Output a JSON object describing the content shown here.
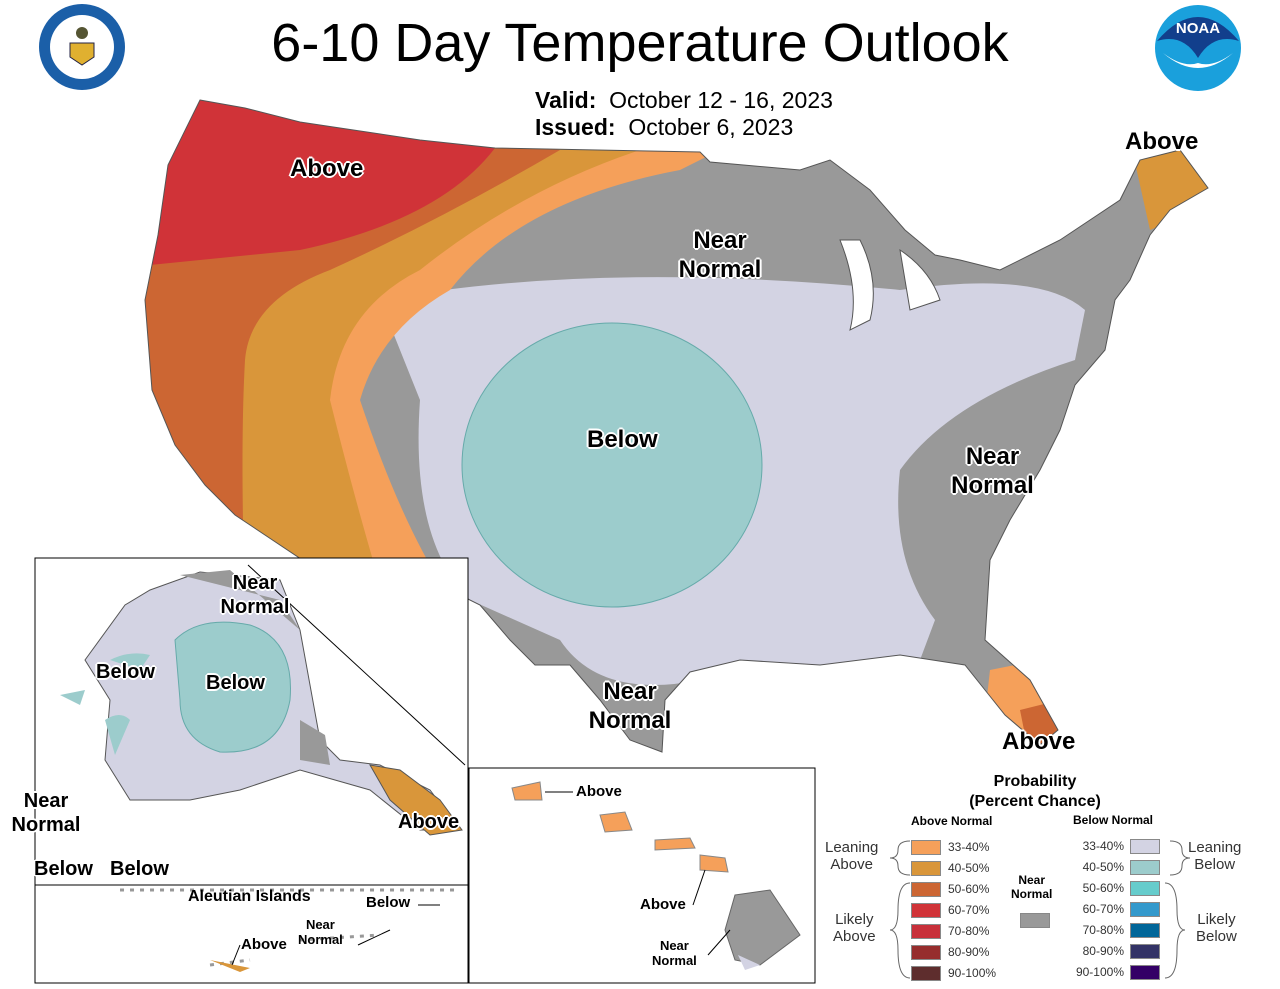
{
  "header": {
    "title": "6-10 Day Temperature Outlook",
    "valid_label": "Valid:",
    "valid_value": "October 12 - 16, 2023",
    "issued_label": "Issued:",
    "issued_value": "October 6, 2023",
    "left_logo": "DEPARTMENT OF COMMERCE UNITED STATES OF AMERICA",
    "right_logo": "NOAA"
  },
  "map_labels": {
    "conus_nw": "Above",
    "conus_north_1": "Near",
    "conus_north_2": "Normal",
    "conus_center": "Below",
    "conus_east_1": "Near",
    "conus_east_2": "Normal",
    "conus_south_1": "Near",
    "conus_south_2": "Normal",
    "conus_maine": "Above",
    "conus_florida": "Above"
  },
  "alaska": {
    "near_normal_1": "Near",
    "near_normal_2": "Normal",
    "below_west": "Below",
    "below_center": "Below",
    "near_normal_w1": "Near",
    "near_normal_w2": "Normal",
    "above_se": "Above",
    "below_sw1": "Below",
    "below_sw2": "Below"
  },
  "aleutian": {
    "title": "Aleutian Islands",
    "below": "Below",
    "near_1": "Near",
    "near_2": "Normal",
    "above": "Above"
  },
  "hawaii": {
    "above_1": "Above",
    "above_2": "Above",
    "near_1": "Near",
    "near_2": "Normal"
  },
  "legend": {
    "title_1": "Probability",
    "title_2": "(Percent Chance)",
    "above_header": "Above Normal",
    "below_header": "Below Normal",
    "leaning_above_1": "Leaning",
    "leaning_above_2": "Above",
    "likely_above_1": "Likely",
    "likely_above_2": "Above",
    "leaning_below_1": "Leaning",
    "leaning_below_2": "Below",
    "likely_below_1": "Likely",
    "likely_below_2": "Below",
    "near_1": "Near",
    "near_2": "Normal",
    "near_color": "#999999",
    "above": [
      {
        "range": "33-40%",
        "color": "#f5a05a"
      },
      {
        "range": "40-50%",
        "color": "#d9963a"
      },
      {
        "range": "50-60%",
        "color": "#cc6633"
      },
      {
        "range": "60-70%",
        "color": "#d03338"
      },
      {
        "range": "70-80%",
        "color": "#c8303a"
      },
      {
        "range": "80-90%",
        "color": "#962d2d"
      },
      {
        "range": "90-100%",
        "color": "#5e2d2d"
      }
    ],
    "below": [
      {
        "range": "33-40%",
        "color": "#d3d3e3"
      },
      {
        "range": "40-50%",
        "color": "#9ccccc"
      },
      {
        "range": "50-60%",
        "color": "#66cccc"
      },
      {
        "range": "60-70%",
        "color": "#3399cc"
      },
      {
        "range": "70-80%",
        "color": "#006699"
      },
      {
        "range": "80-90%",
        "color": "#333366"
      },
      {
        "range": "90-100%",
        "color": "#330066"
      }
    ]
  }
}
